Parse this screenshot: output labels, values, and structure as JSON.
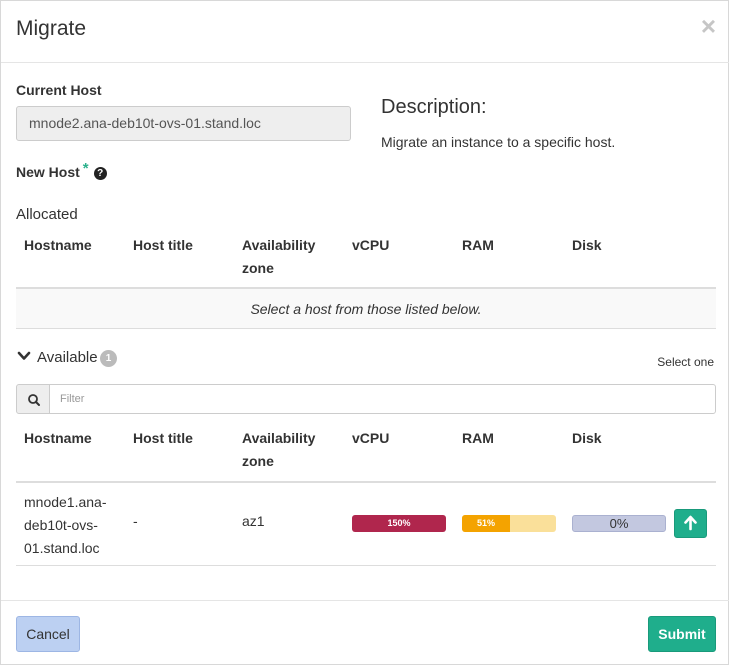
{
  "modal": {
    "title": "Migrate",
    "close_glyph": "×"
  },
  "current_host": {
    "label": "Current Host",
    "value": "mnode2.ana-deb10t-ovs-01.stand.loc"
  },
  "description": {
    "title": "Description:",
    "text": "Migrate an instance to a specific host."
  },
  "new_host": {
    "label": "New Host",
    "required_marker": "*",
    "help_glyph": "?"
  },
  "allocated": {
    "label": "Allocated",
    "columns": [
      "Hostname",
      "Host title",
      "Availability zone",
      "vCPU",
      "RAM",
      "Disk"
    ],
    "empty_message": "Select a host from those listed below."
  },
  "available": {
    "label": "Available",
    "count": "1",
    "select_hint": "Select one",
    "filter_placeholder": "Filter",
    "columns": [
      "Hostname",
      "Host title",
      "Availability zone",
      "vCPU",
      "RAM",
      "Disk"
    ],
    "rows": [
      {
        "hostname": "mnode1.ana-deb10t-ovs-01.stand.loc",
        "host_title": "-",
        "availability_zone": "az1",
        "vcpu_label": "150%",
        "vcpu_fraction": 1.0,
        "ram_label": "51%",
        "ram_fraction": 0.51,
        "disk_label": "0%",
        "disk_fraction": 0.0
      }
    ]
  },
  "colors": {
    "vcpu_bar": "#b0264d",
    "ram_bar": "#f4a300",
    "ram_track": "#fae09a",
    "disk_track": "#c3c8e0",
    "primary": "#1fae8c",
    "cancel": "#bcd0f2"
  },
  "icons": {
    "close": "close-icon",
    "help": "question-circle-icon",
    "chevron": "chevron-down-icon",
    "search": "search-icon",
    "row_action": "arrow-up-icon"
  },
  "footer": {
    "cancel_label": "Cancel",
    "submit_label": "Submit"
  }
}
